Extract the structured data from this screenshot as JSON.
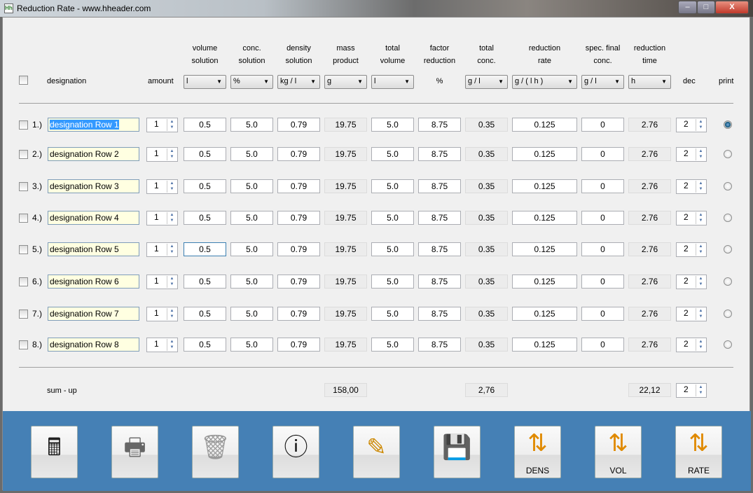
{
  "window": {
    "title": "Reduction Rate - www.hheader.com",
    "icon": "app-icon",
    "minimize": "–",
    "maximize": "□",
    "close": "X"
  },
  "header": {
    "designation": "designation",
    "amount": "amount",
    "dec": "dec",
    "print": "print",
    "columns": [
      {
        "l1": "volume",
        "l2": "solution",
        "unit": "l"
      },
      {
        "l1": "conc.",
        "l2": "solution",
        "unit": "%"
      },
      {
        "l1": "density",
        "l2": "solution",
        "unit": "kg / l"
      },
      {
        "l1": "mass",
        "l2": "product",
        "unit": "g"
      },
      {
        "l1": "total",
        "l2": "volume",
        "unit": "l"
      },
      {
        "l1": "factor",
        "l2": "reduction",
        "unit": "%",
        "static": true
      },
      {
        "l1": "total",
        "l2": "conc.",
        "unit": "g / l"
      },
      {
        "l1": "reduction",
        "l2": "rate",
        "unit": "g / ( l h )"
      },
      {
        "l1": "spec. final",
        "l2": "conc.",
        "unit": "g / l"
      },
      {
        "l1": "reduction",
        "l2": "time",
        "unit": "h"
      }
    ]
  },
  "rows": [
    {
      "num": "1.)",
      "designation": "designation Row 1",
      "amount": "1",
      "values": [
        "0.5",
        "5.0",
        "0.79",
        "19.75",
        "5.0",
        "8.75",
        "0.35",
        "0.125",
        "0",
        "2.76"
      ],
      "dec": "2",
      "print": true
    },
    {
      "num": "2.)",
      "designation": "designation Row 2",
      "amount": "1",
      "values": [
        "0.5",
        "5.0",
        "0.79",
        "19.75",
        "5.0",
        "8.75",
        "0.35",
        "0.125",
        "0",
        "2.76"
      ],
      "dec": "2",
      "print": false
    },
    {
      "num": "3.)",
      "designation": "designation Row 3",
      "amount": "1",
      "values": [
        "0.5",
        "5.0",
        "0.79",
        "19.75",
        "5.0",
        "8.75",
        "0.35",
        "0.125",
        "0",
        "2.76"
      ],
      "dec": "2",
      "print": false
    },
    {
      "num": "4.)",
      "designation": "designation Row 4",
      "amount": "1",
      "values": [
        "0.5",
        "5.0",
        "0.79",
        "19.75",
        "5.0",
        "8.75",
        "0.35",
        "0.125",
        "0",
        "2.76"
      ],
      "dec": "2",
      "print": false
    },
    {
      "num": "5.)",
      "designation": "designation Row 5",
      "amount": "1",
      "values": [
        "0.5",
        "5.0",
        "0.79",
        "19.75",
        "5.0",
        "8.75",
        "0.35",
        "0.125",
        "0",
        "2.76"
      ],
      "dec": "2",
      "print": false
    },
    {
      "num": "6.)",
      "designation": "designation Row 6",
      "amount": "1",
      "values": [
        "0.5",
        "5.0",
        "0.79",
        "19.75",
        "5.0",
        "8.75",
        "0.35",
        "0.125",
        "0",
        "2.76"
      ],
      "dec": "2",
      "print": false
    },
    {
      "num": "7.)",
      "designation": "designation Row 7",
      "amount": "1",
      "values": [
        "0.5",
        "5.0",
        "0.79",
        "19.75",
        "5.0",
        "8.75",
        "0.35",
        "0.125",
        "0",
        "2.76"
      ],
      "dec": "2",
      "print": false
    },
    {
      "num": "8.)",
      "designation": "designation Row 8",
      "amount": "1",
      "values": [
        "0.5",
        "5.0",
        "0.79",
        "19.75",
        "5.0",
        "8.75",
        "0.35",
        "0.125",
        "0",
        "2.76"
      ],
      "dec": "2",
      "print": false
    }
  ],
  "sum": {
    "label": "sum - up",
    "mass": "158,00",
    "conc": "2,76",
    "time": "22,12",
    "dec": "2"
  },
  "toolbar": [
    {
      "name": "calculate",
      "icon": "calculator-icon",
      "label": ""
    },
    {
      "name": "print",
      "icon": "printer-icon",
      "label": ""
    },
    {
      "name": "delete",
      "icon": "trash-icon",
      "label": ""
    },
    {
      "name": "info",
      "icon": "info-icon",
      "label": ""
    },
    {
      "name": "edit",
      "icon": "pencil-ruler-icon",
      "label": ""
    },
    {
      "name": "save",
      "icon": "floppy-disk-icon",
      "label": ""
    },
    {
      "name": "dens",
      "icon": "swap-arrows-icon",
      "label": "DENS"
    },
    {
      "name": "vol",
      "icon": "swap-arrows-icon",
      "label": "VOL"
    },
    {
      "name": "rate",
      "icon": "swap-arrows-icon",
      "label": "RATE"
    }
  ],
  "colors": {
    "toolbar_bg": "#4580b5",
    "selection": "#3399ff",
    "designation_bg": "#ffffe1"
  }
}
